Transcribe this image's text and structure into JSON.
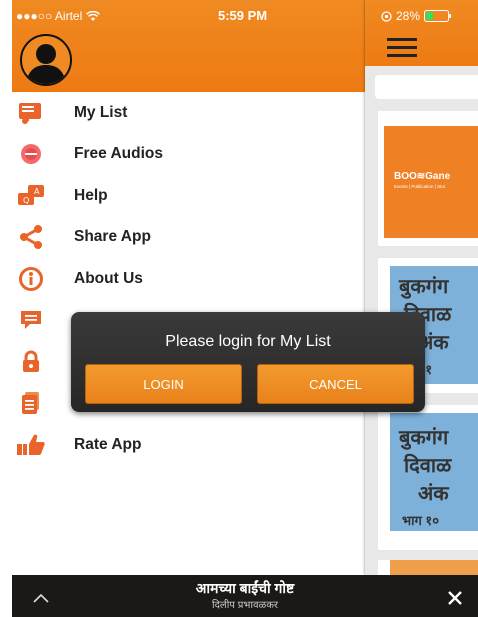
{
  "status_bar": {
    "carrier": "●●●○○ Airtel",
    "time": "5:59 PM",
    "battery": "28%"
  },
  "drawer": {
    "menu_items": [
      {
        "label": "My List",
        "icon": "music-list-icon"
      },
      {
        "label": "Free Audios",
        "icon": "free-audio-badge-icon"
      },
      {
        "label": "Help",
        "icon": "help-chat-icon"
      },
      {
        "label": "Share App",
        "icon": "share-icon"
      },
      {
        "label": "About Us",
        "icon": "info-icon"
      },
      {
        "label": "",
        "icon": "message-icon"
      },
      {
        "label": "",
        "icon": "lock-icon"
      },
      {
        "label": "",
        "icon": "document-icon"
      },
      {
        "label": "Rate App",
        "icon": "thumbs-up-icon"
      }
    ]
  },
  "main": {
    "cards": [
      {
        "brand": "BOO≋Gane",
        "tagline": "Events | Publication | Stor"
      },
      {
        "lines": [
          "बुकगंग",
          "दिवाळ",
          "अंक",
          "भाग १"
        ]
      },
      {
        "lines": [
          "बुकगंग",
          "दिवाळ",
          "अंक",
          "भाग १०"
        ]
      }
    ]
  },
  "dialog": {
    "message": "Please login for My List",
    "login_label": "LOGIN",
    "cancel_label": "CANCEL"
  },
  "player": {
    "title": "आमच्या बाईंची गोष्ट",
    "subtitle": "दिलीप प्रभावळकर"
  },
  "colors": {
    "accent": "#f08a22",
    "dialog_bg": "#2e2e2e",
    "cover_blue": "#7db1d9",
    "player_bg": "#1b1815"
  }
}
